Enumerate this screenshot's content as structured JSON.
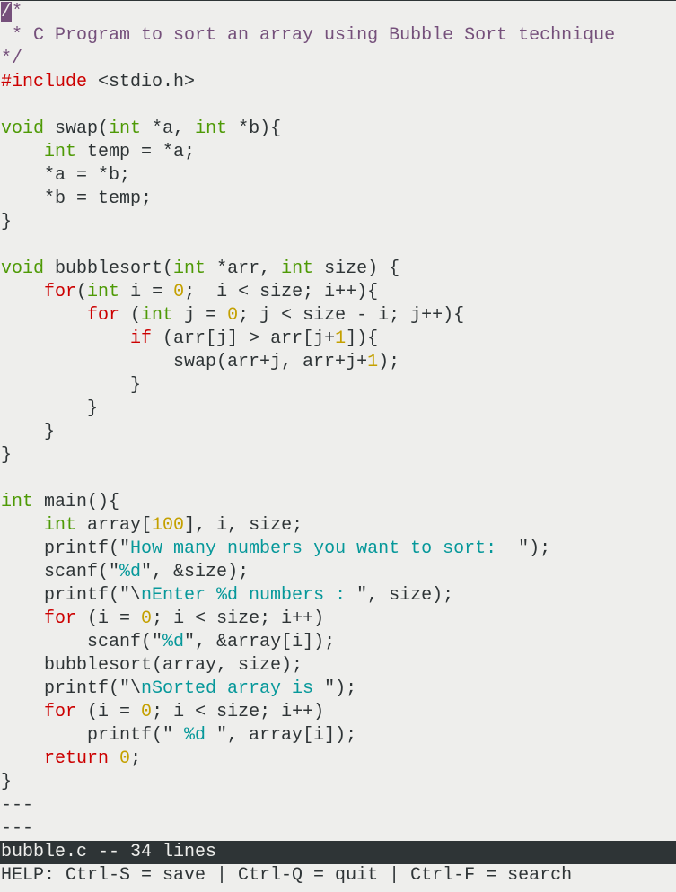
{
  "editor": {
    "colors": {
      "background": "#eeeeec",
      "text": "#2e3436",
      "comment": "#75507b",
      "preproc": "#cc0000",
      "type": "#4e9a06",
      "keyword": "#cc0000",
      "number": "#c4a000",
      "string": "#06989a",
      "cursor": "#75507b",
      "status_bg": "#2e3436",
      "status_fg": "#eeeeec"
    },
    "cursor": {
      "line": 1,
      "column": 1,
      "char": "/"
    },
    "lines": [
      [
        [
          "cursor",
          "/"
        ],
        [
          "comment",
          "*"
        ]
      ],
      [
        [
          "comment",
          " * C Program to sort an array using Bubble Sort technique"
        ]
      ],
      [
        [
          "comment",
          "*/"
        ]
      ],
      [
        [
          "preproc",
          "#include"
        ],
        [
          "plain",
          " <stdio.h>"
        ]
      ],
      [],
      [
        [
          "type",
          "void"
        ],
        [
          "plain",
          " swap("
        ],
        [
          "type",
          "int"
        ],
        [
          "plain",
          " *a, "
        ],
        [
          "type",
          "int"
        ],
        [
          "plain",
          " *b){"
        ]
      ],
      [
        [
          "plain",
          "    "
        ],
        [
          "type",
          "int"
        ],
        [
          "plain",
          " temp = *a;"
        ]
      ],
      [
        [
          "plain",
          "    *a = *b;"
        ]
      ],
      [
        [
          "plain",
          "    *b = temp;"
        ]
      ],
      [
        [
          "plain",
          "}"
        ]
      ],
      [],
      [
        [
          "type",
          "void"
        ],
        [
          "plain",
          " bubblesort("
        ],
        [
          "type",
          "int"
        ],
        [
          "plain",
          " *arr, "
        ],
        [
          "type",
          "int"
        ],
        [
          "plain",
          " size) {"
        ]
      ],
      [
        [
          "plain",
          "    "
        ],
        [
          "keyword",
          "for"
        ],
        [
          "plain",
          "("
        ],
        [
          "type",
          "int"
        ],
        [
          "plain",
          " i = "
        ],
        [
          "number",
          "0"
        ],
        [
          "plain",
          ";  i < size; i++){"
        ]
      ],
      [
        [
          "plain",
          "        "
        ],
        [
          "keyword",
          "for"
        ],
        [
          "plain",
          " ("
        ],
        [
          "type",
          "int"
        ],
        [
          "plain",
          " j = "
        ],
        [
          "number",
          "0"
        ],
        [
          "plain",
          "; j < size - i; j++){"
        ]
      ],
      [
        [
          "plain",
          "            "
        ],
        [
          "keyword",
          "if"
        ],
        [
          "plain",
          " (arr[j] > arr[j+"
        ],
        [
          "number",
          "1"
        ],
        [
          "plain",
          "]){"
        ]
      ],
      [
        [
          "plain",
          "                swap(arr+j, arr+j+"
        ],
        [
          "number",
          "1"
        ],
        [
          "plain",
          ");"
        ]
      ],
      [
        [
          "plain",
          "            }"
        ]
      ],
      [
        [
          "plain",
          "        }"
        ]
      ],
      [
        [
          "plain",
          "    }"
        ]
      ],
      [
        [
          "plain",
          "}"
        ]
      ],
      [],
      [
        [
          "type",
          "int"
        ],
        [
          "plain",
          " main(){"
        ]
      ],
      [
        [
          "plain",
          "    "
        ],
        [
          "type",
          "int"
        ],
        [
          "plain",
          " array["
        ],
        [
          "number",
          "100"
        ],
        [
          "plain",
          "], i, size;"
        ]
      ],
      [
        [
          "plain",
          "    printf(\""
        ],
        [
          "string",
          "How many numbers you want to sort:  "
        ],
        [
          "plain",
          "\");"
        ]
      ],
      [
        [
          "plain",
          "    scanf(\""
        ],
        [
          "string",
          "%d"
        ],
        [
          "plain",
          "\", &size);"
        ]
      ],
      [
        [
          "plain",
          "    printf(\"\\"
        ],
        [
          "string",
          "nEnter %d numbers : "
        ],
        [
          "plain",
          "\", size);"
        ]
      ],
      [
        [
          "plain",
          "    "
        ],
        [
          "keyword",
          "for"
        ],
        [
          "plain",
          " (i = "
        ],
        [
          "number",
          "0"
        ],
        [
          "plain",
          "; i < size; i++)"
        ]
      ],
      [
        [
          "plain",
          "        scanf(\""
        ],
        [
          "string",
          "%d"
        ],
        [
          "plain",
          "\", &array[i]);"
        ]
      ],
      [
        [
          "plain",
          "    bubblesort(array, size);"
        ]
      ],
      [
        [
          "plain",
          "    printf(\"\\"
        ],
        [
          "string",
          "nSorted array is "
        ],
        [
          "plain",
          "\");"
        ]
      ],
      [
        [
          "plain",
          "    "
        ],
        [
          "keyword",
          "for"
        ],
        [
          "plain",
          " (i = "
        ],
        [
          "number",
          "0"
        ],
        [
          "plain",
          "; i < size; i++)"
        ]
      ],
      [
        [
          "plain",
          "        printf(\""
        ],
        [
          "string",
          " %d "
        ],
        [
          "plain",
          "\", array[i]);"
        ]
      ],
      [
        [
          "plain",
          "    "
        ],
        [
          "keyword",
          "return"
        ],
        [
          "plain",
          " "
        ],
        [
          "number",
          "0"
        ],
        [
          "plain",
          ";"
        ]
      ],
      [
        [
          "plain",
          "}"
        ]
      ],
      [
        [
          "tilde",
          "---"
        ]
      ],
      [
        [
          "tilde",
          "---"
        ]
      ]
    ]
  },
  "status_bar": {
    "filename": "bubble.c",
    "separator": " -- ",
    "line_count_label": "34 lines",
    "text": "bubble.c -- 34 lines"
  },
  "help_line": {
    "text": "HELP: Ctrl-S = save | Ctrl-Q = quit | Ctrl-F = search",
    "shortcuts": [
      {
        "keys": "Ctrl-S",
        "action": "save"
      },
      {
        "keys": "Ctrl-Q",
        "action": "quit"
      },
      {
        "keys": "Ctrl-F",
        "action": "search"
      }
    ]
  }
}
